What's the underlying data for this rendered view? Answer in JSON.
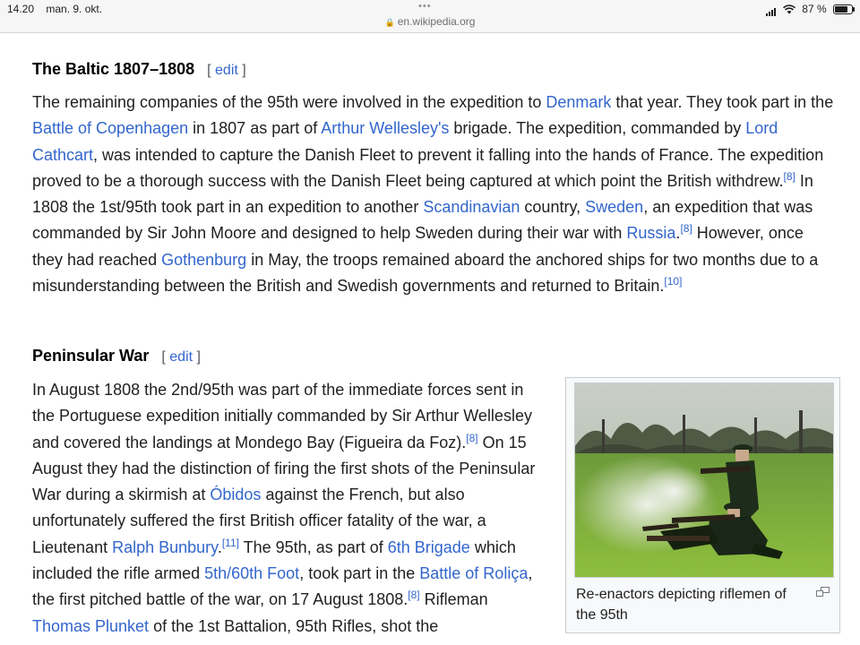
{
  "status_bar": {
    "time": "14.20",
    "date": "man. 9. okt.",
    "url": "en.wikipedia.org",
    "battery": "87 %",
    "battery_level": 0.87
  },
  "sections": [
    {
      "heading": "The Baltic 1807–1808",
      "edit_label": "edit"
    },
    {
      "heading": "Peninsular War",
      "edit_label": "edit"
    }
  ],
  "text": {
    "p1": {
      "s1": "The remaining companies of the 95th were involved in the expedition to ",
      "l1": "Denmark",
      "s2": " that year. They took part in the ",
      "l2": "Battle of Copenhagen",
      "s3": " in 1807 as part of ",
      "l3": "Arthur Wellesley's",
      "s4": " brigade. The expedition, commanded by ",
      "l4": "Lord Cathcart",
      "s5": ", was intended to capture the Danish Fleet to prevent it falling into the hands of France. The expedition proved to be a thorough success with the Danish Fleet being captured at which point the British withdrew.",
      "r1": "[8]",
      "s6": " In 1808 the 1st/95th took part in an expedition to another ",
      "l5": "Scandinavian",
      "s7": " country, ",
      "l6": "Sweden",
      "s8": ", an expedition that was commanded by Sir John Moore and designed to help Sweden during their war with ",
      "l7": "Russia",
      "s9": ".",
      "r2": "[8]",
      "s10": " However, once they had reached ",
      "l8": "Gothenburg",
      "s11": " in May, the troops remained aboard the anchored ships for two months due to a misunderstanding between the British and Swedish governments and returned to Britain.",
      "r3": "[10]"
    },
    "p2": {
      "s1": "In August 1808 the 2nd/95th was part of the immediate forces sent in the Portuguese expedition initially commanded by Sir Arthur Wellesley and covered the landings at Mondego Bay (Figueira da Foz).",
      "r1": "[8]",
      "s2": " On 15 August they had the distinction of firing the first shots of the Peninsular War during a skirmish at ",
      "l1": "Óbidos",
      "s3": " against the French, but also unfortunately suffered the first British officer fatality of the war, a Lieutenant ",
      "l2": "Ralph Bunbury",
      "s4": ".",
      "r2": "[11]",
      "s5": " The 95th, as part of ",
      "l3": "6th Brigade",
      "s6": " which included the rifle armed ",
      "l4": "5th/60th Foot",
      "s7": ", took part in the ",
      "l5": "Battle of Roliça",
      "s8": ", the first pitched battle of the war, on 17 August 1808.",
      "r3": "[8]",
      "s9": " Rifleman ",
      "l6": "Thomas Plunket",
      "s10": " of the 1st Battalion, 95th Rifles, shot the"
    }
  },
  "figure": {
    "caption": "Re-enactors depicting riflemen of the 95th",
    "icon": "enlarge-icon"
  },
  "colors": {
    "link": "#3366cc",
    "text": "#202122",
    "status_bar_bg": "#f6f6f6"
  }
}
